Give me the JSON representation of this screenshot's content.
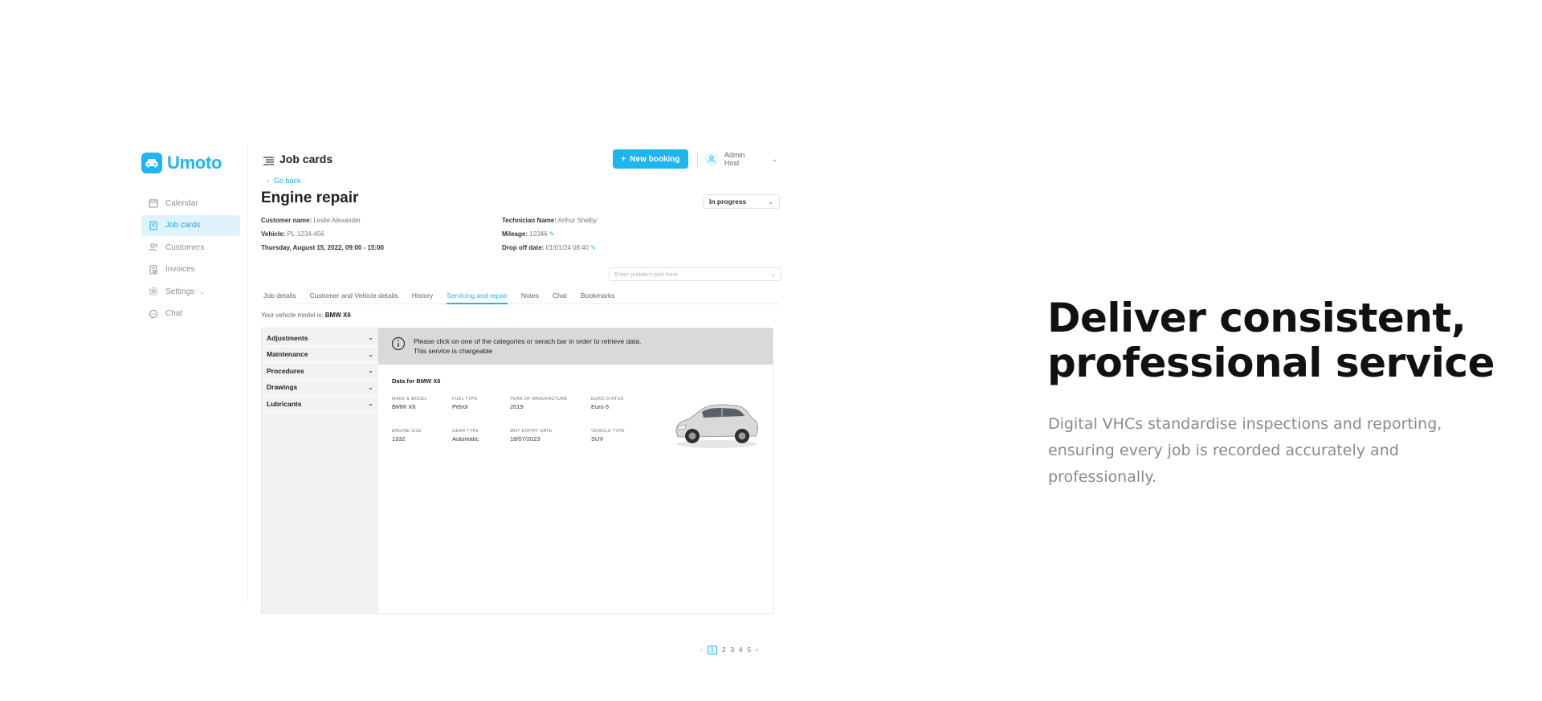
{
  "app": {
    "logo_text": "Umoto",
    "brand_color": "#1fb6ee"
  },
  "sidebar": {
    "items": [
      {
        "label": "Calendar",
        "icon": "calendar-icon"
      },
      {
        "label": "Job cards",
        "icon": "job-card-icon",
        "active": true
      },
      {
        "label": "Customers",
        "icon": "customers-icon"
      },
      {
        "label": "Invoices",
        "icon": "invoice-icon"
      },
      {
        "label": "Settings",
        "icon": "gear-icon",
        "has_submenu": true
      },
      {
        "label": "Chat",
        "icon": "chat-icon"
      }
    ]
  },
  "topbar": {
    "title": "Job cards",
    "new_booking_label": "New booking",
    "user_name": "Admin Host"
  },
  "job": {
    "go_back_label": "Go back",
    "title": "Engine repair",
    "status": "In progress",
    "customer_label": "Customer name:",
    "customer_value": "Leslie Alexander",
    "vehicle_label": "Vehicle:",
    "vehicle_value": "PL-1234-456",
    "date_value": "Thursday, August 15, 2022, 09:00 - 15:00",
    "technician_label": "Technician Name:",
    "technician_value": "Arthur Shelby",
    "mileage_label": "Mileage:",
    "mileage_value": "12346",
    "dropoff_label": "Drop off date:",
    "dropoff_value": "01/01/24 08:40",
    "problem_placeholder": "Enter problem part here"
  },
  "tabs": [
    {
      "label": "Job details"
    },
    {
      "label": "Customer and Vehicle details"
    },
    {
      "label": "History"
    },
    {
      "label": "Servicing and repair",
      "active": true
    },
    {
      "label": "Notes"
    },
    {
      "label": "Chat"
    },
    {
      "label": "Bookmarks"
    }
  ],
  "servicing": {
    "model_prefix": "Your vehicle model is:",
    "model_value": "BMW X6",
    "categories": [
      "Adjustments",
      "Maintenance",
      "Procedures",
      "Drawings",
      "Lubricants"
    ],
    "notice_line1": "Please click on one of the categories or serach bar in order to retrieve data.",
    "notice_line2": "This service is chargeable",
    "data_heading": "Data for BMW X6",
    "specs": [
      {
        "label": "MAKE & MODEL",
        "value": "BMW X6"
      },
      {
        "label": "FUEL TYPE",
        "value": "Petrol"
      },
      {
        "label": "YEAR OF MANUFACTURE",
        "value": "2019"
      },
      {
        "label": "EURO STATUS",
        "value": "Euro 6"
      },
      {
        "label": "ENGINE SIZE",
        "value": "1332"
      },
      {
        "label": "GEAR TYPE",
        "value": "Automatic"
      },
      {
        "label": "MOT EXPIRY DATE",
        "value": "18/07/2023"
      },
      {
        "label": "VEHICLE TYPE",
        "value": "SUV"
      }
    ]
  },
  "pagination": {
    "pages": [
      "1",
      "2",
      "3",
      "4",
      "5"
    ],
    "current": "1"
  },
  "marketing": {
    "headline_line1": "Deliver consistent,",
    "headline_line2": "professional service",
    "body": "Digital VHCs standardise inspections and reporting, ensuring every job is recorded accurately and professionally."
  }
}
